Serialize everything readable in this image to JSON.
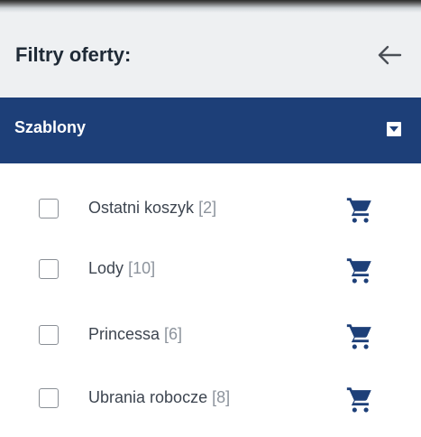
{
  "panel": {
    "title": "Filtry oferty:",
    "back_icon": "arrow-left-icon"
  },
  "section": {
    "title": "Szablony",
    "toggle_icon": "dropdown-arrow-icon",
    "color": "#1d3f78"
  },
  "items": [
    {
      "label": "Ostatni koszyk",
      "count": "[2]",
      "checked": false,
      "icon": "cart-icon"
    },
    {
      "label": "Lody",
      "count": "[10]",
      "checked": false,
      "icon": "cart-icon"
    },
    {
      "label": "Princessa",
      "count": "[6]",
      "checked": false,
      "icon": "cart-icon"
    },
    {
      "label": "Ubrania robocze",
      "count": "[8]",
      "checked": false,
      "icon": "cart-icon"
    }
  ],
  "colors": {
    "accent": "#1d3f78",
    "header_bg": "#eef0f2"
  }
}
